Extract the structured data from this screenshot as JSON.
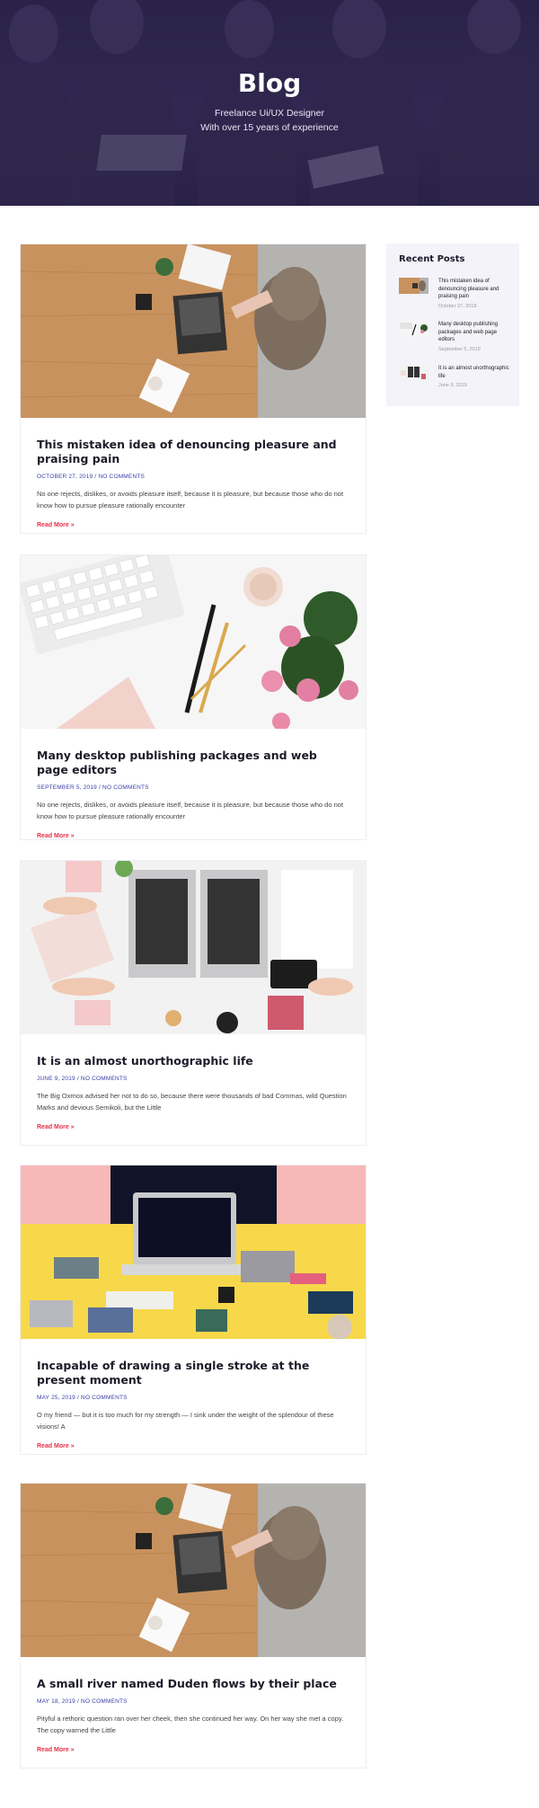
{
  "hero": {
    "title": "Blog",
    "subtitle_line1": "Freelance Ui/UX Designer",
    "subtitle_line2": "With over 15 years of experience"
  },
  "posts": [
    {
      "title": "This mistaken idea of denouncing pleasure and praising pain",
      "date": "OCTOBER 27, 2019",
      "comments": "NO COMMENTS",
      "excerpt": "No one rejects, dislikes, or avoids pleasure itself, because it is pleasure, but because those who do not know how to pursue pleasure rationally encounter",
      "read_more": "Read More »"
    },
    {
      "title": "Many desktop publishing packages and web page editors",
      "date": "SEPTEMBER 5, 2019",
      "comments": "NO COMMENTS",
      "excerpt": "No one rejects, dislikes, or avoids pleasure itself, because it is pleasure, but because those who do not know how to pursue pleasure rationally encounter",
      "read_more": "Read More »"
    },
    {
      "title": "It is an almost unorthographic life",
      "date": "JUNE 9, 2019",
      "comments": "NO COMMENTS",
      "excerpt": "The Big Oxmox advised her not to do so, because there were thousands of bad Commas, wild Question Marks and devious Semikoli, but the Little",
      "read_more": "Read More »"
    },
    {
      "title": "Incapable of drawing a single stroke at the present moment",
      "date": "MAY 25, 2019",
      "comments": "NO COMMENTS",
      "excerpt": "O my friend — but it is too much for my strength — I sink under the weight of the splendour of these visions! A",
      "read_more": "Read More »"
    },
    {
      "title": "A small river named Duden flows by their place",
      "date": "MAY 18, 2019",
      "comments": "NO COMMENTS",
      "excerpt": "Pityful a rethoric question ran over her cheek, then she continued her way. On her way she met a copy. The copy warned the Little",
      "read_more": "Read More »"
    }
  ],
  "sidebar": {
    "title": "Recent Posts",
    "items": [
      {
        "title": "This mistaken idea of denouncing pleasure and praising pain",
        "date": "October 27, 2019"
      },
      {
        "title": "Many desktop publishing packages and web page editors",
        "date": "September 5, 2019"
      },
      {
        "title": "It is an almost unorthographic life",
        "date": "June 9, 2019"
      }
    ]
  },
  "meta_separator": "/",
  "colors": {
    "hero_overlay": "#2c2545",
    "meta_link": "#3a3ea8",
    "read_more": "#e8304a",
    "sidebar_bg": "#f4f3fa"
  }
}
